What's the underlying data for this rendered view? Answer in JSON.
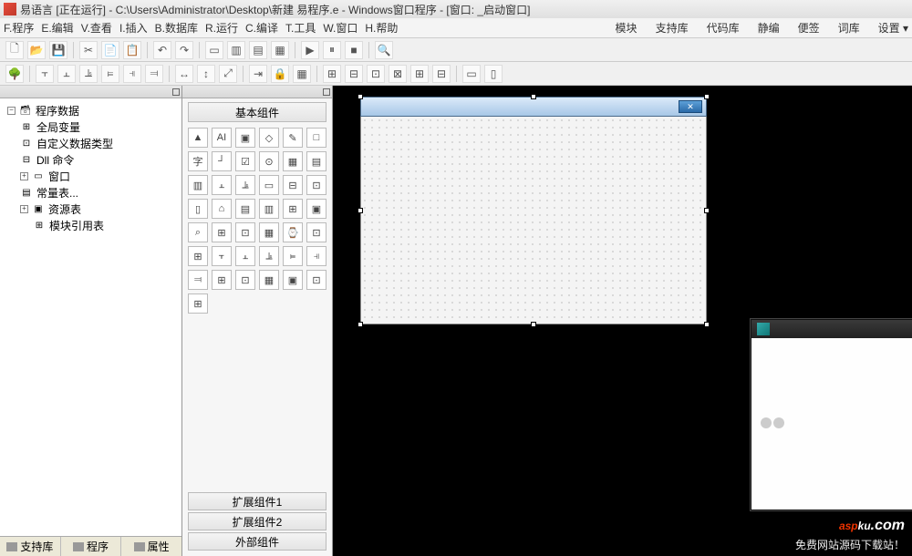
{
  "titlebar": {
    "text": "易语言 [正在运行] - C:\\Users\\Administrator\\Desktop\\新建 易程序.e - Windows窗口程序 - [窗口: _启动窗口]"
  },
  "menu": {
    "items": [
      "F.程序",
      "E.编辑",
      "V.查看",
      "I.插入",
      "B.数据库",
      "R.运行",
      "C.编译",
      "T.工具",
      "W.窗口",
      "H.帮助"
    ],
    "right": [
      "模块",
      "支持库",
      "代码库",
      "静编",
      "便签",
      "词库",
      "设置 ▾"
    ]
  },
  "toolbar1_icons": [
    "new",
    "open",
    "save",
    "|",
    "cut",
    "copy",
    "paste",
    "|",
    "undo",
    "redo",
    "|",
    "layout1",
    "layout2",
    "layout3",
    "layout4",
    "|",
    "run",
    "pause",
    "stop",
    "|",
    "find"
  ],
  "toolbar2_icons": [
    "tree",
    "|",
    "al1",
    "al2",
    "al3",
    "al4",
    "al5",
    "al6",
    "|",
    "sz1",
    "sz2",
    "sz3",
    "|",
    "tab",
    "lock",
    "grid",
    "|",
    "c1",
    "c2",
    "c3",
    "c4",
    "c5",
    "c6",
    "|",
    "m1",
    "m2"
  ],
  "left": {
    "root": "程序数据",
    "children": [
      {
        "label": "全局变量"
      },
      {
        "label": "自定义数据类型"
      },
      {
        "label": "Dll 命令"
      },
      {
        "label": "窗口",
        "exp": "+"
      },
      {
        "label": "常量表..."
      },
      {
        "label": "资源表",
        "exp": "+"
      },
      {
        "label": "模块引用表"
      }
    ],
    "tabs": [
      "支持库",
      "程序",
      "属性"
    ]
  },
  "components": {
    "header": "基本组件",
    "items": [
      "▲",
      "AI",
      "▣",
      "◇",
      "✎",
      "□",
      "字",
      "┘",
      "☑",
      "⊙",
      "▦",
      "▤",
      "▥",
      "⫠",
      "⫡",
      "▭",
      "⊟",
      "⊡",
      "▯",
      "⌂",
      "▤",
      "▥",
      "⊞",
      "▣",
      "⌕",
      "⊞",
      "⊡",
      "▦",
      "⌚",
      "⊡",
      "⊞",
      "⫟",
      "⫠",
      "⫡",
      "⫢",
      "⫣",
      "⫤",
      "⊞",
      "⊡",
      "▦",
      "▣",
      "⊡",
      "⊞"
    ],
    "tabs": [
      "扩展组件1",
      "扩展组件2",
      "外部组件"
    ]
  },
  "popup": {
    "close": "X"
  },
  "watermark": {
    "brand_red": "asp",
    "brand_white": "ku",
    "brand_sm": ".com",
    "tag": "免费网站源码下载站！"
  }
}
